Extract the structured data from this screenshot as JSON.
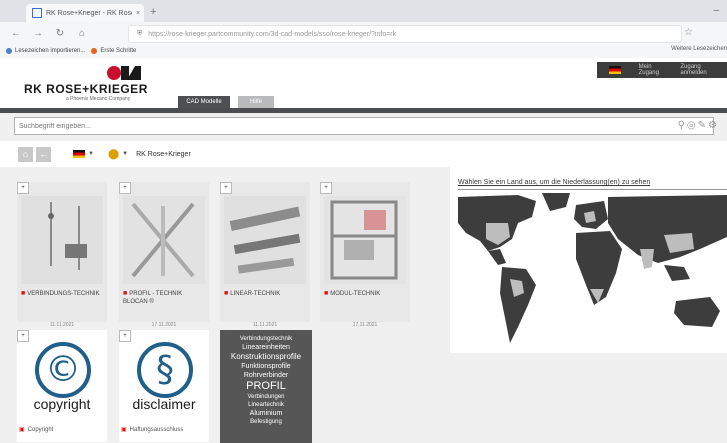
{
  "browser": {
    "tab_title": "RK Rose+Krieger - RK Rose+K...",
    "tab_close": "×",
    "new_tab": "+",
    "address": "https://rose-krieger.partcommunity.com/3d-cad-models/sso/rose-krieger/?info=rk",
    "address_domain": "partcommunity.com",
    "bookmarks": [
      {
        "label": "Lesezeichen importieren...",
        "color": "#4a7fd1"
      },
      {
        "label": "Erste Schritte",
        "color": "#e5621d"
      }
    ],
    "bookmarks_right": "Weitere Lesezeichen"
  },
  "header": {
    "logo_text": "RK ROSE+KRIEGER",
    "logo_tagline": "a Phoenix Mecano Company",
    "my_account": "Mein Zugang",
    "access": "Zugang anmelden",
    "logo_colors": {
      "red": "#c8102e",
      "dark": "#1a1a1a"
    }
  },
  "tabs": [
    {
      "label": "CAD Modelle",
      "active": true
    },
    {
      "label": "Hilfe",
      "active": false
    }
  ],
  "search": {
    "placeholder": "Suchbegriff eingeben..."
  },
  "toolbar": {
    "home_icon": "home-icon",
    "back_icon": "back-icon",
    "breadcrumb": "RK Rose+Krieger"
  },
  "categories": [
    {
      "name": "VERBINDUNGS-TECHNIK",
      "date": "11.11.2021"
    },
    {
      "name": "PROFIL - TECHNIK BLOCAN ®",
      "date": "17.11.2021"
    },
    {
      "name": "LINEAR-TECHNIK",
      "date": "11.11.2021"
    },
    {
      "name": "MODUL-TECHNIK",
      "date": "17.11.2021"
    }
  ],
  "symbol_cards": [
    {
      "symbol": "©",
      "word": "copyright",
      "caption": "Copyright"
    },
    {
      "symbol": "§",
      "word": "disclaimer",
      "caption": "Haftungsausschluss"
    }
  ],
  "tag_cloud": [
    {
      "text": "Verbindungstechnik",
      "size": 6
    },
    {
      "text": "Lineareinheiten",
      "size": 7
    },
    {
      "text": "Konstruktionsprofile",
      "size": 8
    },
    {
      "text": "Funktionsprofile",
      "size": 7
    },
    {
      "text": "Rohrverbinder",
      "size": 7
    },
    {
      "text": "PROFIL",
      "size": 11
    },
    {
      "text": "Verbindungen",
      "size": 6
    },
    {
      "text": "Lineartechnik",
      "size": 6
    },
    {
      "text": "Aluminium",
      "size": 7
    },
    {
      "text": "Befestigung",
      "size": 6
    }
  ],
  "map": {
    "title": "Wählen Sie ein Land aus, um die Niederlassung(en) zu sehen",
    "land_color": "#3d3d3d",
    "highlight_color": "#bdbdbd",
    "ocean_color": "#ffffff"
  }
}
